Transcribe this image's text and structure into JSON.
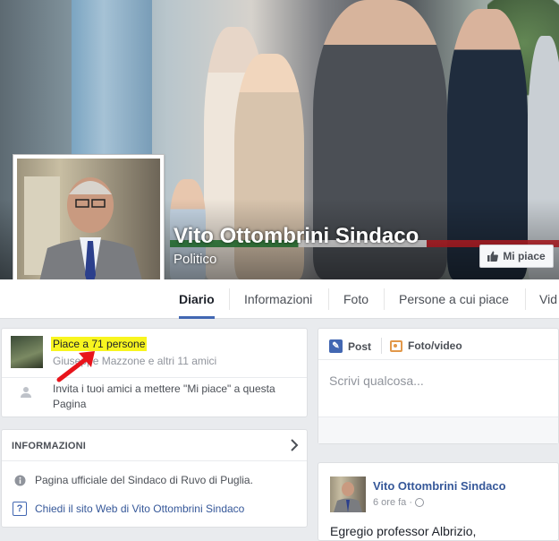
{
  "page": {
    "name": "Vito Ottombrini Sindaco",
    "category": "Politico",
    "like_button": "Mi piace"
  },
  "nav": {
    "tabs": [
      {
        "label": "Diario",
        "active": true
      },
      {
        "label": "Informazioni",
        "active": false
      },
      {
        "label": "Foto",
        "active": false
      },
      {
        "label": "Persone a cui piace",
        "active": false
      },
      {
        "label": "Vid",
        "active": false
      }
    ]
  },
  "likes_card": {
    "count_text": "Piace a 71 persone",
    "friends_text": "Giuseppe Mazzone e altri 11 amici",
    "invite_text": "Invita i tuoi amici a mettere \"Mi piace\" a questa Pagina"
  },
  "info_card": {
    "header": "INFORMAZIONI",
    "description": "Pagina ufficiale del Sindaco di Ruvo di Puglia.",
    "website_link": "Chiedi il sito Web di Vito Ottombrini Sindaco"
  },
  "composer": {
    "tab_post": "Post",
    "tab_photo": "Foto/video",
    "placeholder": "Scrivi qualcosa..."
  },
  "post": {
    "author": "Vito Ottombrini Sindaco",
    "time": "6 ore fa · ",
    "text": "Egregio professor Albrizio,"
  },
  "colors": {
    "highlight": "#f8f51f",
    "accent": "#4267b2",
    "link": "#365899",
    "annotation_arrow": "#e8141b"
  }
}
